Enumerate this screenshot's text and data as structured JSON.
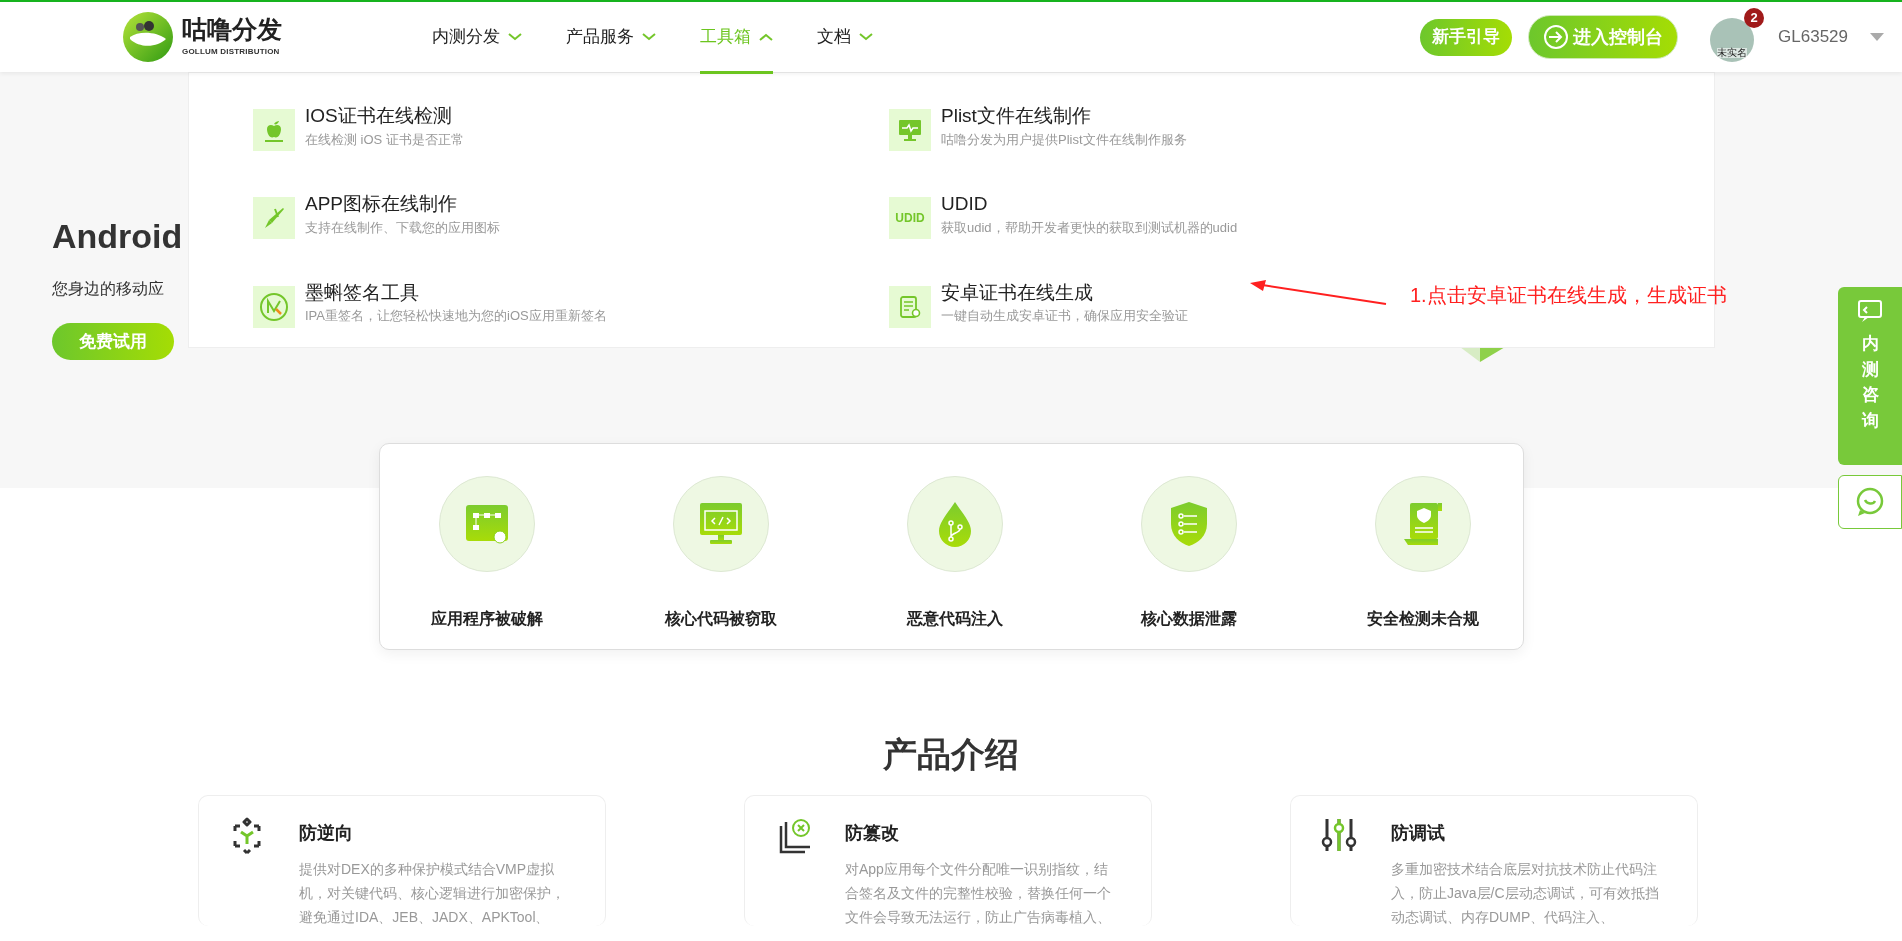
{
  "header": {
    "logo": {
      "name": "咕噜分发",
      "subtitle": "GOLLUM DISTRIBUTION"
    },
    "nav": [
      {
        "label": "内测分发",
        "selected": false,
        "expanded": false
      },
      {
        "label": "产品服务",
        "selected": false,
        "expanded": false
      },
      {
        "label": "工具箱",
        "selected": true,
        "expanded": true
      },
      {
        "label": "文档",
        "selected": false,
        "expanded": false
      }
    ],
    "guide_button": "新手引导",
    "console_button": "进入控制台",
    "user": {
      "avatar_label": "未实名",
      "badge": "2",
      "name": "GL63529"
    }
  },
  "toolbox_menu": [
    {
      "kind": "apple",
      "title": "IOS证书在线检测",
      "description": "在线检测 iOS 证书是否正常"
    },
    {
      "kind": "monitor",
      "title": "Plist文件在线制作",
      "description": "咕噜分发为用户提供Plist文件在线制作服务"
    },
    {
      "kind": "pen",
      "title": "APP图标在线制作",
      "description": "支持在线制作、下载您的应用图标"
    },
    {
      "kind": "udid",
      "icon_text": "UDID",
      "title": "UDID",
      "description": "获取udid，帮助开发者更快的获取到测试机器的udid"
    },
    {
      "kind": "sign",
      "title": "墨蝌签名工具",
      "description": "IPA重签名，让您轻松快速地为您的iOS应用重新签名"
    },
    {
      "kind": "cert",
      "title": "安卓证书在线生成",
      "description": "一键自动生成安卓证书，确保应用安全验证"
    }
  ],
  "annotation": {
    "text": "1.点击安卓证书在线生成，生成证书"
  },
  "hero": {
    "title": "Android",
    "subtitle": "您身边的移动应",
    "button": "免费试用"
  },
  "side_panel": {
    "consult": "内测咨询"
  },
  "risks": [
    {
      "kind": "flow",
      "label": "应用程序被破解"
    },
    {
      "kind": "code",
      "label": "核心代码被窃取"
    },
    {
      "kind": "drop",
      "label": "恶意代码注入"
    },
    {
      "kind": "shield",
      "label": "核心数据泄露"
    },
    {
      "kind": "doc",
      "label": "安全检测未合规"
    }
  ],
  "products": {
    "heading": "产品介绍",
    "cards": [
      {
        "kind": "cube",
        "title": "防逆向",
        "description": "提供对DEX的多种保护模式结合VMP虚拟机，对关键代码、核心逻辑进行加密保护，避免通过IDA、JEB、JADX、APKTool、"
      },
      {
        "kind": "layers",
        "title": "防篡改",
        "description": "对App应用每个文件分配唯一识别指纹，结合签名及文件的完整性校验，替换任何一个文件会导致无法运行，防止广告病毒植入、"
      },
      {
        "kind": "sliders",
        "title": "防调试",
        "description": "多重加密技术结合底层对抗技术防止代码注入，防止Java层/C层动态调试，可有效抵挡动态调试、内存DUMP、代码注入、"
      }
    ]
  }
}
